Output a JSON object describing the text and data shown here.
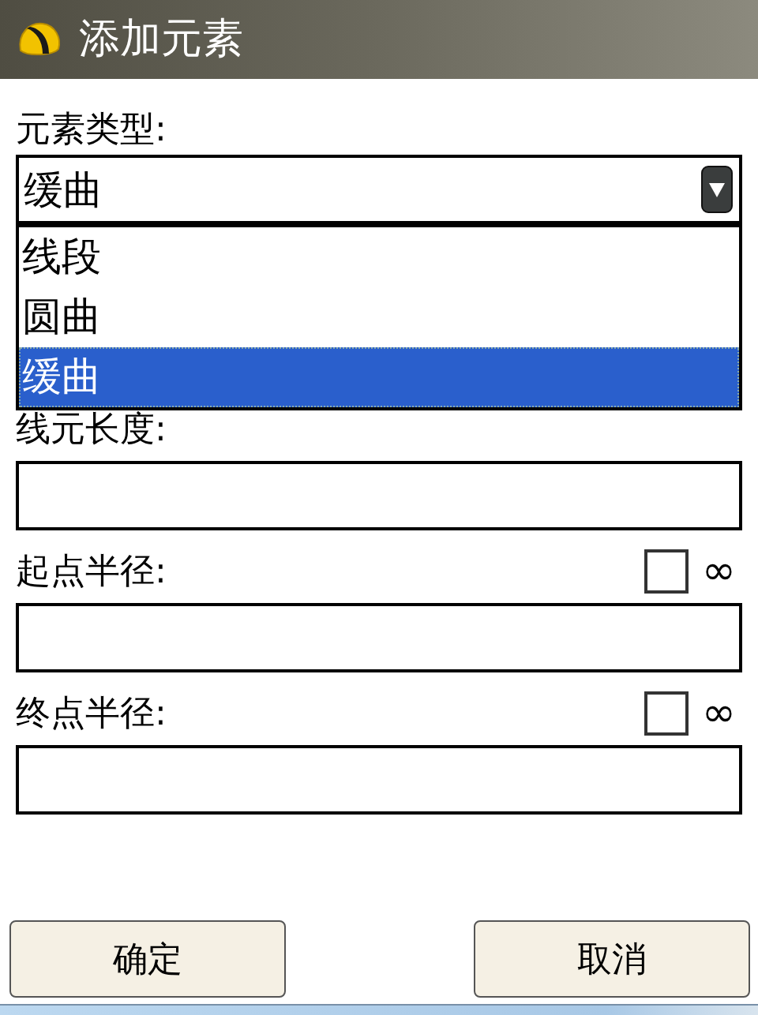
{
  "window": {
    "title": "添加元素"
  },
  "element_type": {
    "label": "元素类型:",
    "value": "缓曲",
    "expanded": true,
    "options": [
      {
        "label": "线段",
        "selected": false
      },
      {
        "label": "圆曲",
        "selected": false
      },
      {
        "label": "缓曲",
        "selected": true
      }
    ]
  },
  "fields": [
    {
      "label": "线元长度:"
    },
    {
      "label": "起点半径:",
      "infinity": {
        "checked": false,
        "symbol": "∞"
      }
    },
    {
      "label": "终点半径:",
      "infinity": {
        "checked": false,
        "symbol": "∞"
      }
    }
  ],
  "buttons": [
    "确定",
    "取消"
  ]
}
